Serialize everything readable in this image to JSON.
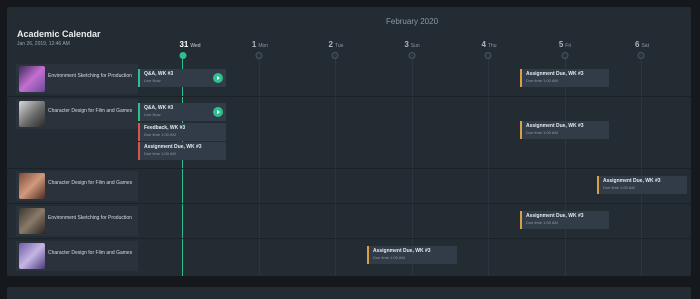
{
  "header": {
    "title": "Academic Calendar",
    "datetime": "Jan 26, 2019, 12:46 AM",
    "month": "February 2020"
  },
  "days": [
    {
      "num": "31",
      "name": "Wed",
      "today": true
    },
    {
      "num": "1",
      "name": "Mon",
      "today": false
    },
    {
      "num": "2",
      "name": "Tue",
      "today": false
    },
    {
      "num": "3",
      "name": "Sun",
      "today": false
    },
    {
      "num": "4",
      "name": "Thu",
      "today": false
    },
    {
      "num": "5",
      "name": "Fri",
      "today": false
    },
    {
      "num": "6",
      "name": "Sat",
      "today": false
    }
  ],
  "courses": [
    {
      "name": "Environment Sketching for Production",
      "thumb": "portrait-purple"
    },
    {
      "name": "Character Design for Film and Games",
      "thumb": "portrait-bw"
    },
    {
      "name": "Character Design for Film and Games",
      "thumb": "portrait-warm"
    },
    {
      "name": "Environment Sketching for Production",
      "thumb": "portrait-dark"
    },
    {
      "name": "Character Design for Film and Games",
      "thumb": "portrait-violet"
    }
  ],
  "events": {
    "qa_live_1": {
      "title": "Q&A, WK #3",
      "sub": "Live Now"
    },
    "due_r1": {
      "title": "Assignment Due, WK #3",
      "sub": "Due time 1:00 AM"
    },
    "qa_live_2": {
      "title": "Q&A, WK #3",
      "sub": "Live Now"
    },
    "feedback_r2": {
      "title": "Feedback, WK #3",
      "sub": "Due time 1:00 AM"
    },
    "due_r2_wed": {
      "title": "Assignment Due, WK #3",
      "sub": "Due time 1:00 AM"
    },
    "due_r2_fri": {
      "title": "Assignment Due, WK #3",
      "sub": "Due time 1:00 AM"
    },
    "due_r3": {
      "title": "Assignment Due, WK #3",
      "sub": "Due time 1:00 AM"
    },
    "due_r4": {
      "title": "Assignment Due, WK #3",
      "sub": "Due time 1:00 AM"
    },
    "due_r5": {
      "title": "Assignment Due, WK #3",
      "sub": "Due time 1:00 AM"
    }
  },
  "colors": {
    "accent_green": "#2fbf8f",
    "due_orange": "#d9a04a",
    "feedback_red": "#d9534f",
    "panel_bg": "#232b33"
  }
}
